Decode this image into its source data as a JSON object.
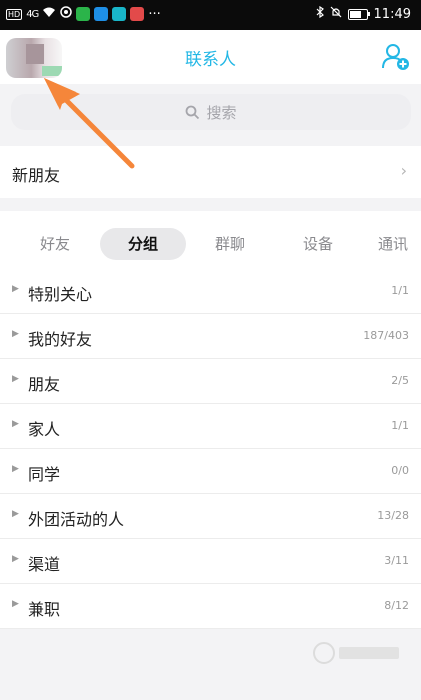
{
  "status_bar": {
    "time": "11:49",
    "hd": "HD",
    "signal": "4G",
    "more": "···",
    "battery_level": 0.7
  },
  "header": {
    "title": "联系人"
  },
  "search": {
    "placeholder": "搜索"
  },
  "new_friends": {
    "label": "新朋友",
    "chevron": "›"
  },
  "tabs": [
    {
      "label": "好友",
      "active": false
    },
    {
      "label": "分组",
      "active": true
    },
    {
      "label": "群聊",
      "active": false
    },
    {
      "label": "设备",
      "active": false
    },
    {
      "label": "通讯",
      "active": false
    }
  ],
  "groups": [
    {
      "name": "特别关心",
      "count": "1/1"
    },
    {
      "name": "我的好友",
      "count": "187/403"
    },
    {
      "name": "朋友",
      "count": "2/5"
    },
    {
      "name": "家人",
      "count": "1/1"
    },
    {
      "name": "同学",
      "count": "0/0"
    },
    {
      "name": "外团活动的人",
      "count": "13/28"
    },
    {
      "name": "渠道",
      "count": "3/11"
    },
    {
      "name": "兼职",
      "count": "8/12"
    }
  ],
  "colors": {
    "accent": "#23b7e5",
    "pointer": "#f5863a"
  }
}
